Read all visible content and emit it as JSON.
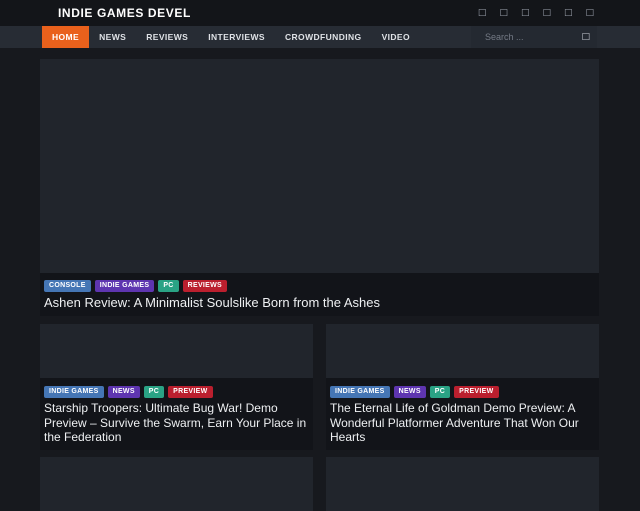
{
  "site": {
    "logo": "INDIE GAMES DEVEL"
  },
  "header": {
    "social_icons": [
      {
        "name": "social-icon-1",
        "glyph": "□"
      },
      {
        "name": "social-icon-2",
        "glyph": "□"
      },
      {
        "name": "social-icon-3",
        "glyph": "□"
      },
      {
        "name": "social-icon-4",
        "glyph": "□"
      },
      {
        "name": "social-icon-5",
        "glyph": "□"
      },
      {
        "name": "social-icon-6",
        "glyph": "□"
      }
    ]
  },
  "nav": {
    "items": [
      {
        "label": "HOME",
        "active": true
      },
      {
        "label": "NEWS",
        "active": false
      },
      {
        "label": "REVIEWS",
        "active": false
      },
      {
        "label": "INTERVIEWS",
        "active": false
      },
      {
        "label": "CROWDFUNDING",
        "active": false
      },
      {
        "label": "VIDEO",
        "active": false
      }
    ],
    "search": {
      "placeholder": "Search ...",
      "button_glyph": "□"
    }
  },
  "colors": {
    "accent_orange": "#e9611c",
    "tag_blue": "#4576b5",
    "tag_purple": "#5e35b0",
    "tag_teal": "#2aa385",
    "tag_red": "#bb1f2e",
    "page_bg": "#17191e",
    "panel_bg": "#21252c",
    "caption_bg": "#121419",
    "navbar_bg": "#272c34"
  },
  "hero": {
    "tags": [
      {
        "label": "CONSOLE",
        "color": "#4576b5"
      },
      {
        "label": "INDIE GAMES",
        "color": "#5e35b0"
      },
      {
        "label": "PC",
        "color": "#2aa385"
      },
      {
        "label": "REVIEWS",
        "color": "#bb1f2e"
      }
    ],
    "title": "Ashen Review: A Minimalist Soulslike Born from the Ashes"
  },
  "cards": [
    {
      "tags": [
        {
          "label": "INDIE GAMES",
          "color": "#4576b5"
        },
        {
          "label": "NEWS",
          "color": "#5e35b0"
        },
        {
          "label": "PC",
          "color": "#2aa385"
        },
        {
          "label": "PREVIEW",
          "color": "#bb1f2e"
        }
      ],
      "title": "Starship Troopers: Ultimate Bug War! Demo Preview – Survive the Swarm, Earn Your Place in the Federation"
    },
    {
      "tags": [
        {
          "label": "INDIE GAMES",
          "color": "#4576b5"
        },
        {
          "label": "NEWS",
          "color": "#5e35b0"
        },
        {
          "label": "PC",
          "color": "#2aa385"
        },
        {
          "label": "PREVIEW",
          "color": "#bb1f2e"
        }
      ],
      "title": "The Eternal Life of Goldman Demo Preview: A Wonderful Platformer Adventure That Won Our Hearts"
    }
  ]
}
